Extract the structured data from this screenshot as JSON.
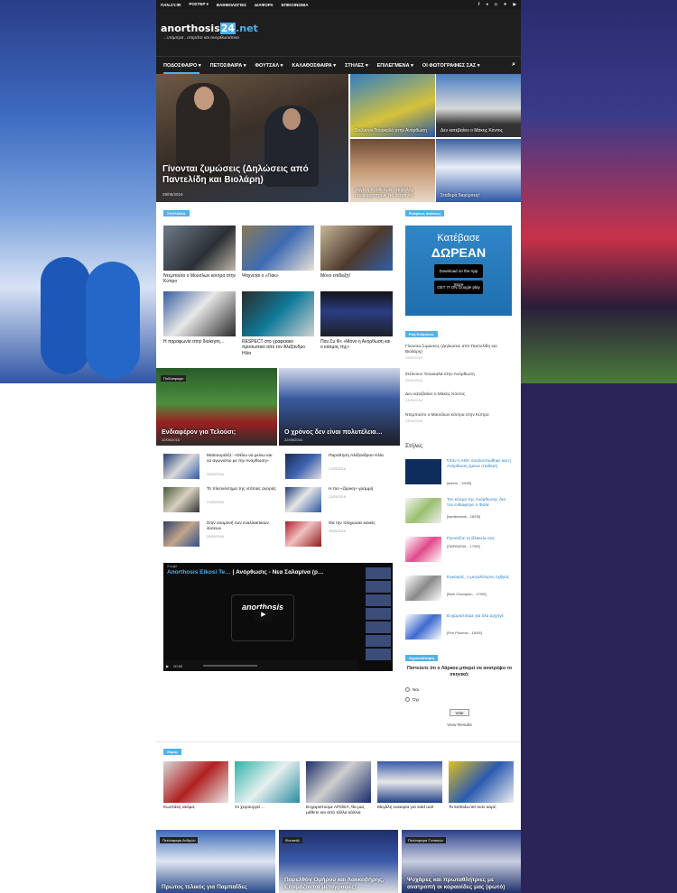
{
  "topbar": {
    "items": [
      "ΠΑΝ.ΣΥ.ΦΙ",
      "ΡΟΣΤΕΡ ▾",
      "ΒΑΘΜΟΛΟΓΙΕΣ",
      "ΔΙΑΦΟΡΑ",
      "ΕΠΙΚΟΙΝΩΝΙΑ"
    ],
    "social": [
      "facebook-icon",
      "flickr-icon",
      "instagram-icon",
      "twitter-icon",
      "youtube-icon"
    ]
  },
  "brand": {
    "name": "anorthosis",
    "num": "24",
    "tld": ".net",
    "slogan": "...ντόμπρα , σταράτα και ανορθωσιάτικα",
    "accent": "#4db2ec"
  },
  "nav": {
    "items": [
      "ΠΟΔΟΣΦΑΙΡΟ ▾",
      "ΠΕΤΟΣΦΑΙΡΑ ▾",
      "ΦΟΥΤΣΑΛ ▾",
      "ΚΑΛΑΘΟΣΦΑΙΡΑ ▾",
      "ΣΤΗΛΕΣ ▾",
      "ΕΠΙΛΕΓΜΕΝΑ ▾",
      "ΟΙ ΦΩΤΟΓΡΑΦΙΕΣ ΣΑΣ ▾"
    ]
  },
  "hero": {
    "main_title": "Γίνονται ζυμώσεις (Δηλώσεις από Παντελίδη και Βιολάρη)",
    "main_date": "29/05/2016",
    "small": [
      "Στέλνουν Τσουκαλά στην Ανόρθωση",
      "Δεν κατεβαίνει ο Μάκης Κόντος",
      "Λήγει η προθεσμία υποβολής υποψηφιοτήτων (τα διάφανα)",
      "Σταθερά διεγέρσεις!"
    ]
  },
  "sections": {
    "news": "ΣΧΟΛΙΑΚΑ",
    "sports": "Χόρος"
  },
  "news_tiles": [
    "Ντεμπούτο ο Μούσλων κόντρα στην Κύπρο",
    "Ψάχνεται ο «Γίακ»",
    "Μόνο επίδειξη!",
    "Η παραφωνία στην διοίκηση…",
    "RESPECT στο γραφειακό προσωπικό από τον Αλέξανδρο Ηλία",
    "Παν.Συ.Φι: «Μόνο η Ανόρθωση και ο κόσμος της»"
  ],
  "features": [
    {
      "tag": "Ποδόσφαιρο",
      "title": "Ενδιαφέρον για Τελούσι;",
      "date": "22/05/2016"
    },
    {
      "title": "Ο χρόνος δεν είναι πολυτέλεια…",
      "date": "22/05/2016"
    }
  ],
  "list": [
    {
      "title": "Μαϊσουράτζε: «Θέλω να μείνω και να αγωνιστώ με την Ανόρθωση»",
      "date": "22/05/2016"
    },
    {
      "title": "Παραίτηση Αλέξανδρου Ηλία",
      "date": "21/05/2016"
    },
    {
      "title": "Το πλεονέκτημα της ντόπιας αγοράς",
      "date": "21/05/2016"
    },
    {
      "title": "Η πιο «ζόρικη» γραμμή",
      "date": "21/05/2016"
    },
    {
      "title": "Στην αναμονή των εναλλακτικών λύσεων",
      "date": "20/05/2016"
    },
    {
      "title": "Θα την πληρώσει κανείς",
      "date": "20/05/2016"
    }
  ],
  "video": {
    "source": "Google",
    "channel": "Anorthosis Eikosi Te…",
    "title": "Ανόρθωσις - Νεα Σαλαμίνα (p…",
    "time": "00:00",
    "logo": "anorthosis"
  },
  "side": {
    "label": "Ενόψεως ανέσεως",
    "app": {
      "line1": "Κατέβασε",
      "line2": "ΔΩΡΕΑΝ",
      "appstore": "Download on the App Store",
      "google": "GET IT ON Google play"
    },
    "feed_label": "Ροή Ειδήσεων",
    "feed": [
      {
        "title": "Γίνονται ζυμώσεις (Δηλώσεις από Παντελίδη και Βιολάρη)",
        "date": "29/05/2016"
      },
      {
        "title": "Στέλνουν Τσουκαλά στην Ανόρθωση",
        "date": "29/05/2016"
      },
      {
        "title": "Δεν κατεβαίνει ο Μάκης Κόντος",
        "date": "23/05/2016"
      },
      {
        "title": "Ντεμπούτο ο Μούσλων κόντρα στην Κύπρο",
        "date": "23/05/2016"
      }
    ],
    "columns_title": "Στήλες",
    "columns": [
      {
        "title": "Όταν η ΑΕΚ σουλουπώθηκε και η Ανόρθωση έμεινε σταθερή",
        "meta": "[admin…19/05]"
      },
      {
        "title": "Τον κόσμο της Ανόρθωσης δεν τον ενδιαφέρει ο Φαλέ",
        "meta": "[karabinatos…18/05]"
      },
      {
        "title": "Προσέξτε τη βλακεία σας",
        "meta": "[ΠΑΡΑΝΟΙΑ…17/05]"
      },
      {
        "title": "Εγκαιρός, ο μεγαλύτερος εχθρός",
        "meta": "[Blue Champion…17/05]"
      },
      {
        "title": "Ευχαριστούμε για όλα αρχηγέ",
        "meta": "[Fire Phoenix…15/05]"
      }
    ],
    "poll_label": "Δημοσκόπηση",
    "poll": {
      "question": "Πιστεύετε ότι ο Λάρκου μπορεί να ανατρέψει το σκηνικό;",
      "options": [
        "Ναι",
        "Όχι"
      ],
      "vote": "Vote",
      "results": "View Results"
    }
  },
  "sports": [
    "Κωστάκη ακόμα;",
    "Οι χειρουργεί…",
    "Ευχαριστούμε ΑΠΟΕΛ, θα μας μάθετε και από τάλλα κάλλια",
    "Μεγάλη ευκαιρία για sold out!",
    "To kerkida.net ουτε καρέ;"
  ],
  "bottom": [
    {
      "tag": "Πετόσφαιρα Ανδρών",
      "title": "Πρώτος τελικός για Παμπαΐδες"
    },
    {
      "tag": "Φουτσάλ",
      "title": "Παρελθόν Ομήρου και Λακκοβήρης, Ετοιμάζονται μεταγραφές!"
    },
    {
      "tag": "Πετόσφαιρα Γυναικών",
      "title": "Ψυχάρες και πρωταθλήτριες με ανατροπή οι κοραοίδες μας (φωτό)"
    }
  ]
}
